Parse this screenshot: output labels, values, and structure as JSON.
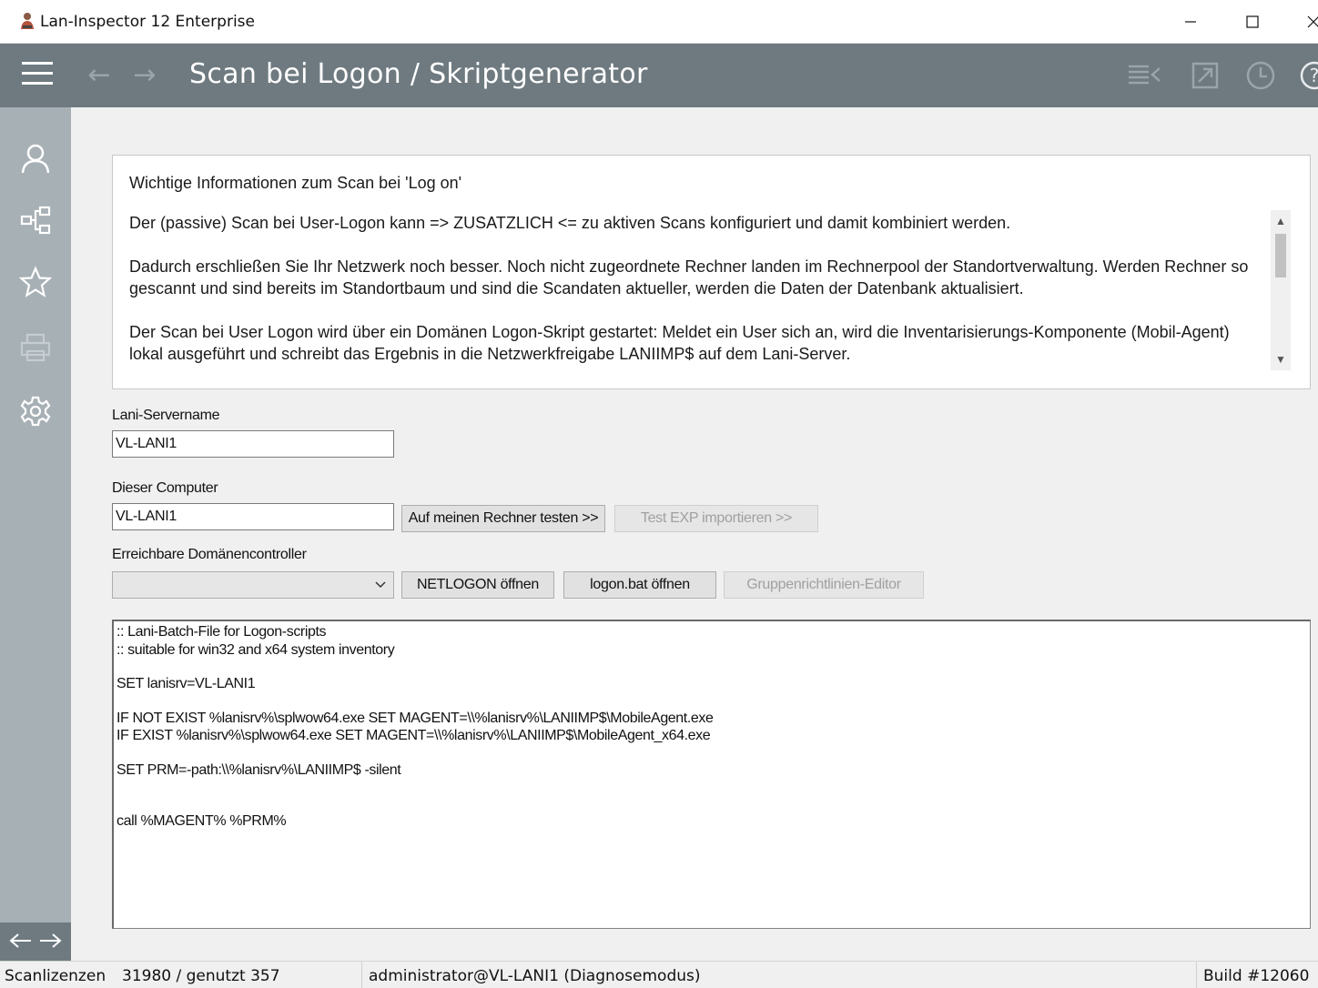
{
  "window": {
    "title": "Lan-Inspector 12 Enterprise"
  },
  "header": {
    "page_title": "Scan bei Logon / Skriptgenerator",
    "icons": [
      "hamburger-icon",
      "back-arrow-icon",
      "forward-arrow-icon",
      "list-view-icon",
      "export-icon",
      "history-clock-icon",
      "help-icon"
    ]
  },
  "sidebar": {
    "icons": [
      "user-icon",
      "network-tree-icon",
      "star-icon",
      "printer-icon",
      "gear-icon"
    ]
  },
  "info": {
    "title": "Wichtige Informationen zum Scan bei 'Log on'",
    "paragraph1": "Der (passive) Scan bei User-Logon kann  => ZUSATZLICH <=  zu aktiven Scans konfiguriert und damit kombiniert werden.",
    "paragraph2": "Dadurch erschließen Sie Ihr Netzwerk noch besser. Noch nicht zugeordnete Rechner landen im Rechnerpool der Standortverwaltung.  Werden Rechner so gescannt und sind bereits im Standortbaum und sind die Scandaten aktueller, werden die Daten der Datenbank aktualisiert.",
    "paragraph3": "Der Scan bei User Logon wird über ein Domänen Logon-Skript gestartet: Meldet ein User sich an, wird die Inventarisierungs-Komponente (Mobil-Agent) lokal ausgeführt und schreibt das Ergebnis in die Netzwerkfreigabe LANIIMP$ auf dem Lani-Server."
  },
  "form": {
    "servername_label": "Lani-Servername",
    "servername_value": "VL-LANI1",
    "computer_label": "Dieser Computer",
    "computer_value": "VL-LANI1",
    "test_button": "Auf meinen Rechner testen >>",
    "import_button": "Test EXP importieren >>",
    "dc_label": "Erreichbare Domänencontroller",
    "dc_value": "",
    "netlogon_button": "NETLOGON öffnen",
    "logonbat_button": "logon.bat öffnen",
    "gpo_button": "Gruppenrichtlinien-Editor"
  },
  "script": {
    "lines": [
      ":: Lani-Batch-File for Logon-scripts",
      ":: suitable for win32 and x64 system inventory",
      "",
      "SET lanisrv=VL-LANI1",
      "",
      "IF NOT EXIST %lanisrv%\\splwow64.exe SET MAGENT=\\\\%lanisrv%\\LANIIMP$\\MobileAgent.exe",
      "IF EXIST %lanisrv%\\splwow64.exe SET MAGENT=\\\\%lanisrv%\\LANIIMP$\\MobileAgent_x64.exe",
      "",
      "SET PRM=-path:\\\\%lanisrv%\\LANIIMP$ -silent",
      "",
      "",
      "call %MAGENT% %PRM%"
    ]
  },
  "status": {
    "licenses_label": "Scanlizenzen",
    "licenses_value": "31980 / genutzt 357",
    "user": "administrator@VL-LANI1 (Diagnosemodus)",
    "build": "Build #12060"
  },
  "colors": {
    "header": "#6e7a80",
    "sidebar": "#a7b0b5",
    "content": "#f0f0f0"
  }
}
